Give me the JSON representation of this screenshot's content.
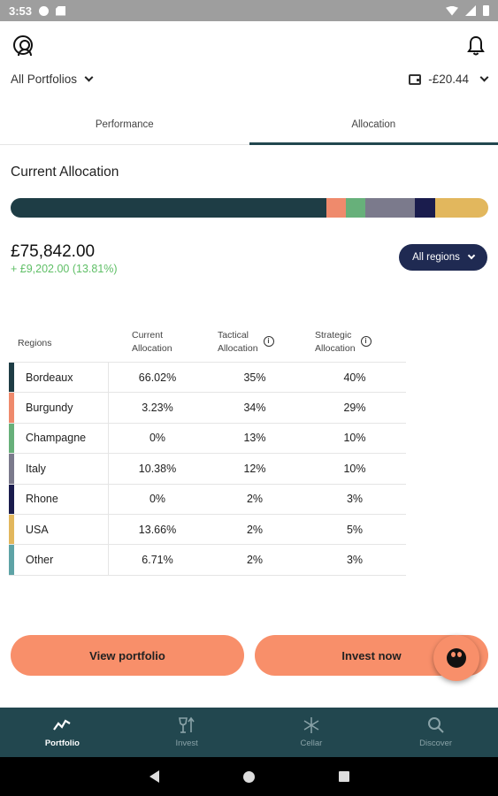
{
  "status_bar": {
    "time": "3:53"
  },
  "header": {
    "portfolio_selector": "All Portfolios",
    "cash_balance": "-£20.44"
  },
  "tabs": [
    {
      "label": "Performance",
      "active": false
    },
    {
      "label": "Allocation",
      "active": true
    }
  ],
  "allocation": {
    "title": "Current Allocation",
    "total_value": "£75,842.00",
    "gain": "+ £9,202.00 (13.81%)",
    "region_filter": "All regions",
    "bar_segments": [
      {
        "region": "Bordeaux",
        "fraction": 0.6602,
        "color": "#1e3d45"
      },
      {
        "region": "Burgundy",
        "fraction": 0.0416,
        "color": "#ef8a6c"
      },
      {
        "region": "Champagne",
        "fraction": 0.0416,
        "color": "#67b07a"
      },
      {
        "region": "Italy",
        "fraction": 0.1038,
        "color": "#7b7a8c"
      },
      {
        "region": "Rhone",
        "fraction": 0.0416,
        "color": "#1a1c4d"
      },
      {
        "region": "USA",
        "fraction": 0.1112,
        "color": "#e2b75d"
      }
    ]
  },
  "table": {
    "headers": {
      "regions": "Regions",
      "current_l1": "Current",
      "current_l2": "Allocation",
      "tactical_l1": "Tactical",
      "tactical_l2": "Allocation",
      "strategic_l1": "Strategic",
      "strategic_l2": "Allocation"
    },
    "rows": [
      {
        "region": "Bordeaux",
        "current": "66.02%",
        "tactical": "35%",
        "strategic": "40%",
        "color": "#1e3d45"
      },
      {
        "region": "Burgundy",
        "current": "3.23%",
        "tactical": "34%",
        "strategic": "29%",
        "color": "#ef8a6c"
      },
      {
        "region": "Champagne",
        "current": "0%",
        "tactical": "13%",
        "strategic": "10%",
        "color": "#67b07a"
      },
      {
        "region": "Italy",
        "current": "10.38%",
        "tactical": "12%",
        "strategic": "10%",
        "color": "#7b7a8c"
      },
      {
        "region": "Rhone",
        "current": "0%",
        "tactical": "2%",
        "strategic": "3%",
        "color": "#1a1c4d"
      },
      {
        "region": "USA",
        "current": "13.66%",
        "tactical": "2%",
        "strategic": "5%",
        "color": "#e2b75d"
      },
      {
        "region": "Other",
        "current": "6.71%",
        "tactical": "2%",
        "strategic": "3%",
        "color": "#5ea3a6"
      }
    ]
  },
  "actions": {
    "view_portfolio": "View portfolio",
    "invest_now": "Invest now"
  },
  "bottom_nav": [
    {
      "label": "Portfolio",
      "icon": "portfolio-chart-icon",
      "active": true
    },
    {
      "label": "Invest",
      "icon": "invest-glass-icon",
      "active": false
    },
    {
      "label": "Cellar",
      "icon": "cellar-snowflake-icon",
      "active": false
    },
    {
      "label": "Discover",
      "icon": "search-icon",
      "active": false
    }
  ]
}
